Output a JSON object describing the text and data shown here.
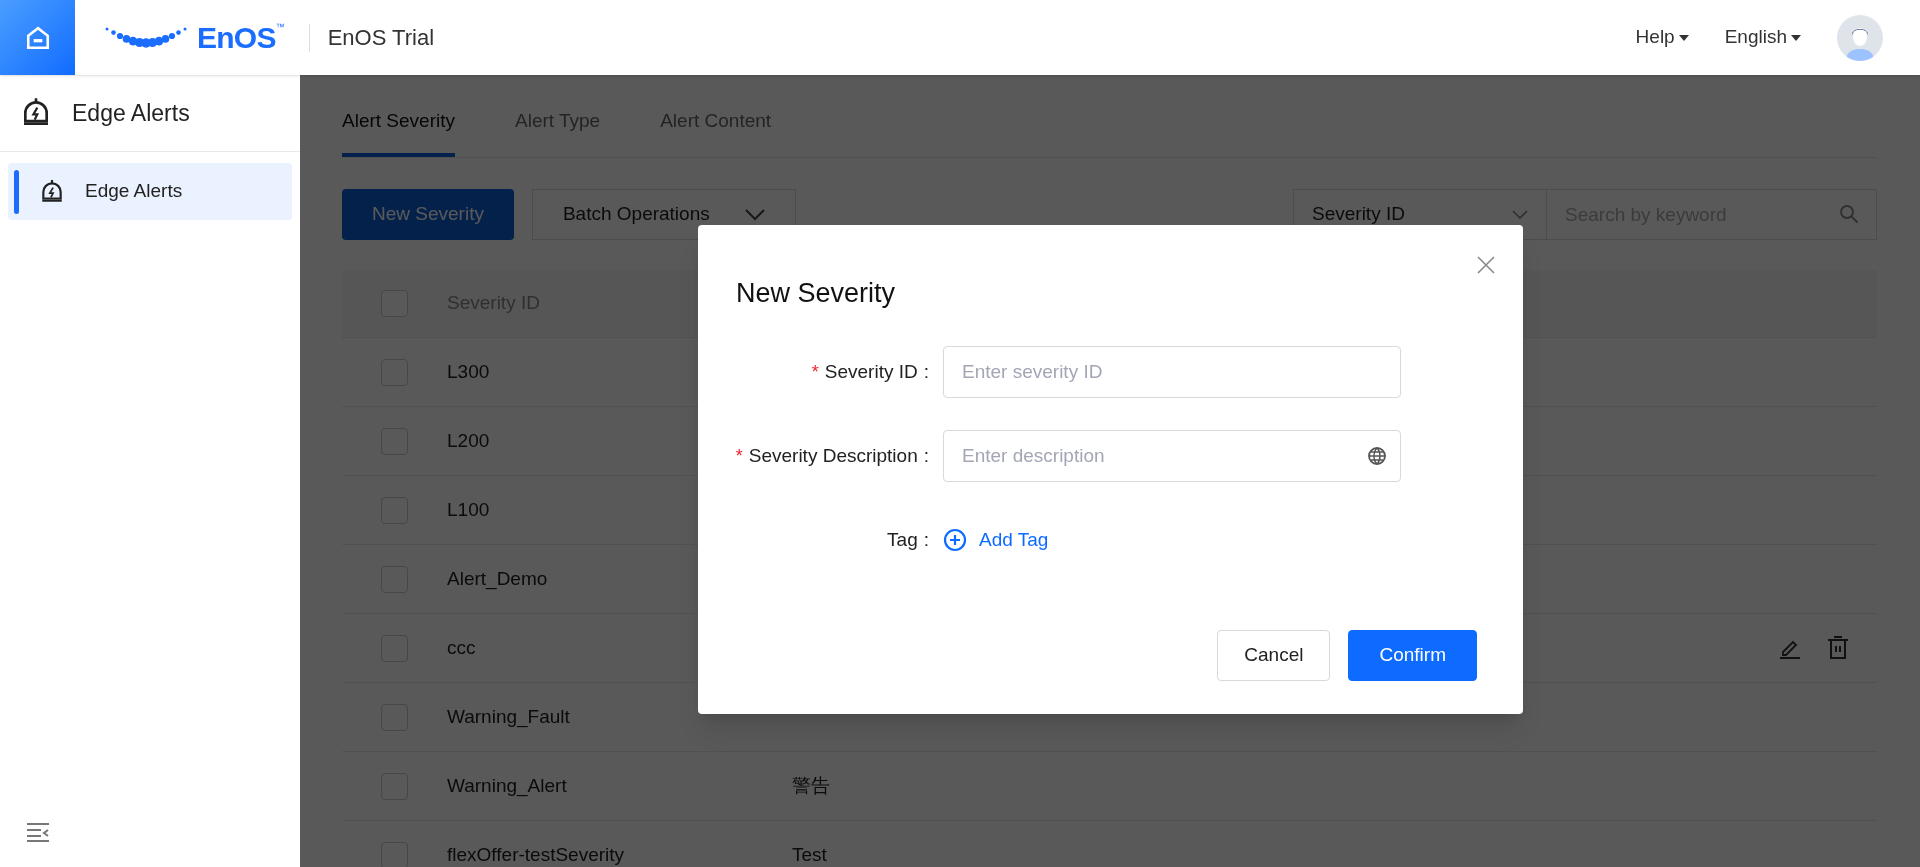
{
  "header": {
    "logo_text": "EnOS",
    "logo_mark": "™",
    "app_name": "EnOS Trial",
    "menus": [
      {
        "label": "Help"
      },
      {
        "label": "English"
      }
    ]
  },
  "sidebar": {
    "title": "Edge Alerts",
    "items": [
      {
        "label": "Edge Alerts",
        "selected": true
      }
    ]
  },
  "tabs": [
    {
      "label": "Alert Severity",
      "selected": true
    },
    {
      "label": "Alert Type",
      "selected": false
    },
    {
      "label": "Alert Content",
      "selected": false
    }
  ],
  "toolbar": {
    "new_button": "New Severity",
    "batch_button": "Batch Operations",
    "filter_select": "Severity ID",
    "search": {
      "placeholder": "Search by keyword"
    }
  },
  "table": {
    "header_checked": false,
    "columns": [
      "Severity ID"
    ],
    "rows": [
      {
        "id": "L300",
        "checked": false,
        "show_actions": false
      },
      {
        "id": "L200",
        "checked": false,
        "show_actions": false
      },
      {
        "id": "L100",
        "checked": false,
        "show_actions": false
      },
      {
        "id": "Alert_Demo",
        "checked": false,
        "show_actions": false
      },
      {
        "id": "ccc",
        "checked": false,
        "show_actions": true
      },
      {
        "id": "Warning_Fault",
        "checked": false,
        "show_actions": false
      },
      {
        "id": "Warning_Alert",
        "description": "警告",
        "checked": false,
        "show_actions": false
      },
      {
        "id": "flexOffer-testSeverity",
        "description": "Test",
        "checked": false,
        "show_actions": false
      }
    ]
  },
  "dialog": {
    "title": "New Severity",
    "fields": [
      {
        "label": "Severity ID",
        "colon": ":",
        "required_mark": "*",
        "placeholder": "Enter severity ID",
        "kind": "text"
      },
      {
        "label": "Severity Description",
        "colon": ":",
        "required_mark": "*",
        "placeholder": "Enter description",
        "kind": "translatable"
      }
    ],
    "tag": {
      "label": "Tag",
      "colon": ":",
      "action": "Add Tag"
    },
    "buttons": [
      {
        "label": "Cancel",
        "kind": "secondary"
      },
      {
        "label": "Confirm",
        "kind": "primary"
      }
    ]
  }
}
